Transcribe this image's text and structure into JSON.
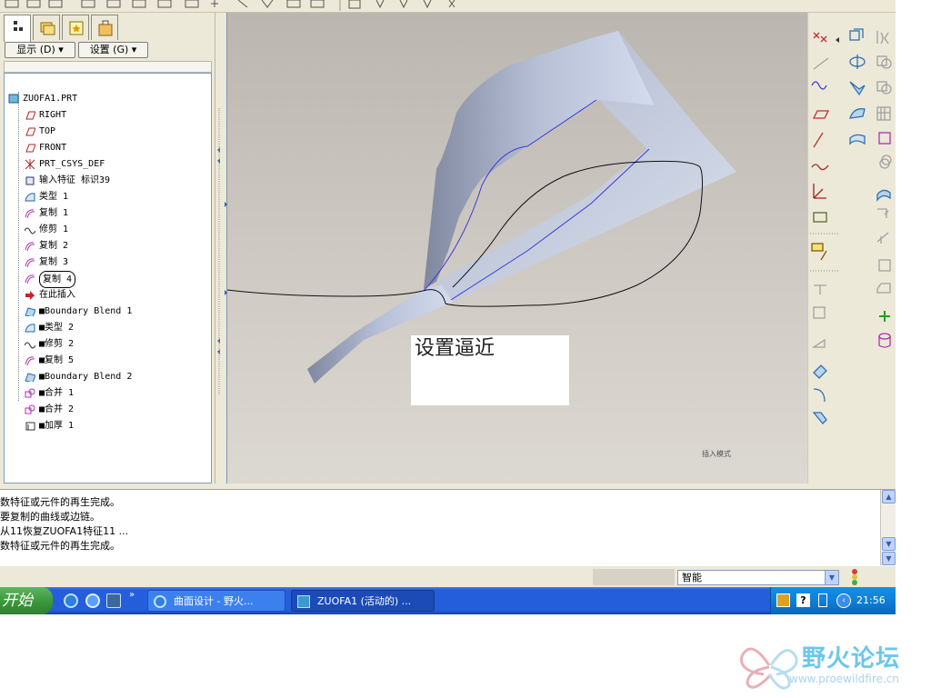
{
  "tree": {
    "show_label": "显示 (D) ▾",
    "settings_label": "设置 (G) ▾",
    "root": "ZUOFA1.PRT",
    "items": [
      {
        "label": "RIGHT",
        "icon": "datum-plane-icon"
      },
      {
        "label": "TOP",
        "icon": "datum-plane-icon"
      },
      {
        "label": "FRONT",
        "icon": "datum-plane-icon"
      },
      {
        "label": "PRT_CSYS_DEF",
        "icon": "csys-icon"
      },
      {
        "label": "输入特征 标识39",
        "icon": "import-feature-icon"
      },
      {
        "label": "类型 1",
        "icon": "surface-icon"
      },
      {
        "label": "复制 1",
        "icon": "copy-icon"
      },
      {
        "label": "修剪 1",
        "icon": "trim-icon"
      },
      {
        "label": "复制 2",
        "icon": "copy-icon"
      },
      {
        "label": "复制 3",
        "icon": "copy-icon"
      },
      {
        "label": "复制 4",
        "icon": "copy-icon"
      },
      {
        "label": "在此插入",
        "icon": "insert-here-arrow-icon"
      },
      {
        "label": "■Boundary Blend 1",
        "icon": "boundary-blend-icon"
      },
      {
        "label": "■类型 2",
        "icon": "surface-icon"
      },
      {
        "label": "■修剪 2",
        "icon": "trim-icon"
      },
      {
        "label": "■复制 5",
        "icon": "copy-icon"
      },
      {
        "label": "■Boundary Blend 2",
        "icon": "boundary-blend-icon"
      },
      {
        "label": "■合并 1",
        "icon": "merge-icon"
      },
      {
        "label": "■合并 2",
        "icon": "merge-icon"
      },
      {
        "label": "■加厚 1",
        "icon": "thicken-icon"
      }
    ]
  },
  "viewport": {
    "note": "设置逼近",
    "mode_label": "插入模式"
  },
  "messages": [
    "数特征或元件的再生完成。",
    "要复制的曲线或边链。",
    "从11恢复ZUOFA1特征11 ...",
    "数特征或元件的再生完成。"
  ],
  "status": {
    "filter": "智能"
  },
  "taskbar": {
    "start": "开始",
    "tasks": [
      "曲面设计 - 野火...",
      "ZUOFA1 (活动的) ..."
    ],
    "clock": "21:56"
  },
  "watermark": {
    "title": "野火论坛",
    "url": "www.proewildfire.cn"
  },
  "colors": {
    "surface": "#c9d4ea",
    "surface_edge": "#3a3ad8",
    "sketch": "#111111",
    "taskbar": "#245edb"
  }
}
